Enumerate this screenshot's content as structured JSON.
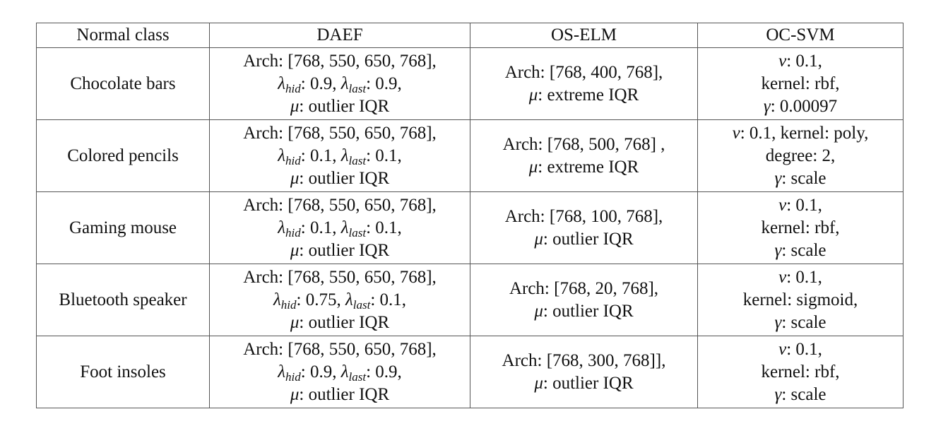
{
  "table": {
    "headers": [
      "Normal class",
      "DAEF",
      "OS-ELM",
      "OC-SVM"
    ],
    "rows": [
      {
        "normal_class": "Chocolate bars",
        "daef": {
          "arch": "Arch: [768, 550, 650, 768],",
          "lambda_hid": ": 0.9, ",
          "lambda_last": ": 0.9,",
          "mu": ": outlier IQR"
        },
        "os_elm": {
          "arch": "Arch: [768, 400, 768],",
          "mu": ": extreme IQR"
        },
        "oc_svm": {
          "lines": [
            {
              "sym": "ν",
              "text": ": 0.1,"
            },
            {
              "sym": "",
              "text": "kernel: rbf,"
            },
            {
              "sym": "γ",
              "text": ": 0.00097"
            }
          ]
        }
      },
      {
        "normal_class": "Colored pencils",
        "daef": {
          "arch": "Arch: [768, 550, 650, 768],",
          "lambda_hid": ": 0.1, ",
          "lambda_last": ": 0.1,",
          "mu": ": outlier IQR"
        },
        "os_elm": {
          "arch": "Arch: [768, 500, 768] ,",
          "mu": ": extreme IQR"
        },
        "oc_svm": {
          "lines": [
            {
              "sym": "ν",
              "text": ": 0.1, kernel: poly,"
            },
            {
              "sym": "",
              "text": "degree: 2,"
            },
            {
              "sym": "γ",
              "text": ": scale"
            }
          ]
        }
      },
      {
        "normal_class": "Gaming mouse",
        "daef": {
          "arch": "Arch: [768, 550, 650, 768],",
          "lambda_hid": ": 0.1, ",
          "lambda_last": ": 0.1,",
          "mu": ": outlier IQR"
        },
        "os_elm": {
          "arch": "Arch: [768, 100, 768],",
          "mu": ": outlier IQR"
        },
        "oc_svm": {
          "lines": [
            {
              "sym": "ν",
              "text": ": 0.1,"
            },
            {
              "sym": "",
              "text": "kernel: rbf,"
            },
            {
              "sym": "γ",
              "text": ": scale"
            }
          ]
        }
      },
      {
        "normal_class": "Bluetooth speaker",
        "daef": {
          "arch": "Arch: [768, 550, 650, 768],",
          "lambda_hid": ": 0.75, ",
          "lambda_last": ": 0.1,",
          "mu": ": outlier IQR"
        },
        "os_elm": {
          "arch": "Arch: [768, 20, 768],",
          "mu": ": outlier IQR"
        },
        "oc_svm": {
          "lines": [
            {
              "sym": "ν",
              "text": ": 0.1,"
            },
            {
              "sym": "",
              "text": "kernel: sigmoid,"
            },
            {
              "sym": "γ",
              "text": ": scale"
            }
          ]
        }
      },
      {
        "normal_class": "Foot insoles",
        "daef": {
          "arch": "Arch: [768, 550, 650, 768],",
          "lambda_hid": ": 0.9, ",
          "lambda_last": ": 0.9,",
          "mu": ": outlier IQR"
        },
        "os_elm": {
          "arch": "Arch: [768, 300, 768]],",
          "mu": ": outlier IQR"
        },
        "oc_svm": {
          "lines": [
            {
              "sym": "ν",
              "text": ": 0.1,"
            },
            {
              "sym": "",
              "text": "kernel: rbf,"
            },
            {
              "sym": "γ",
              "text": ": scale"
            }
          ]
        }
      }
    ]
  },
  "symbols": {
    "lambda": "λ",
    "mu": "μ",
    "hid_sub": "hid",
    "last_sub": "last"
  }
}
